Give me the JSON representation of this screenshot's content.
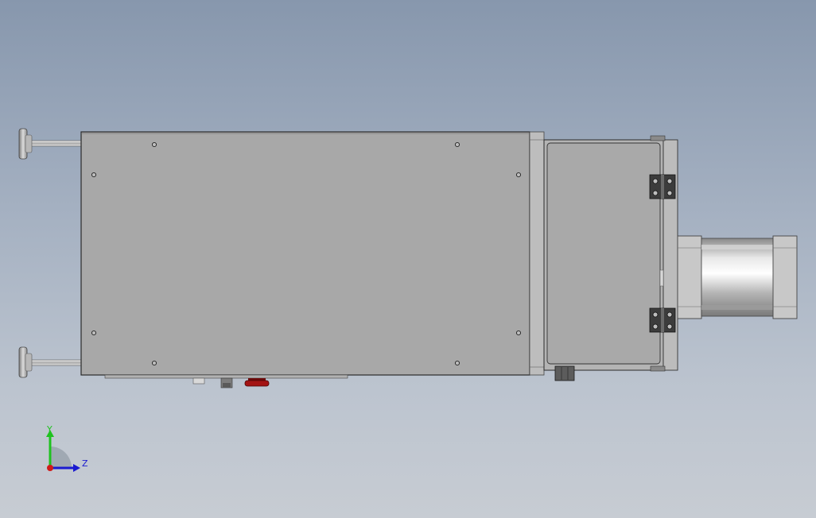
{
  "viewport": {
    "background_top": "#8797ad",
    "background_bottom": "#c7ccd3"
  },
  "model": {
    "body_color": "#a8a8a8",
    "edge_color": "#2a2a2a",
    "hinge_color": "#3c3c3c",
    "knob_color": "#9e1010",
    "cylinder_color": "#c8c8c8"
  },
  "triad": {
    "y_label": "Y",
    "z_label": "Z",
    "y_color": "#1fc21f",
    "z_color": "#1a1ad0",
    "x_color": "#d01a1a"
  }
}
